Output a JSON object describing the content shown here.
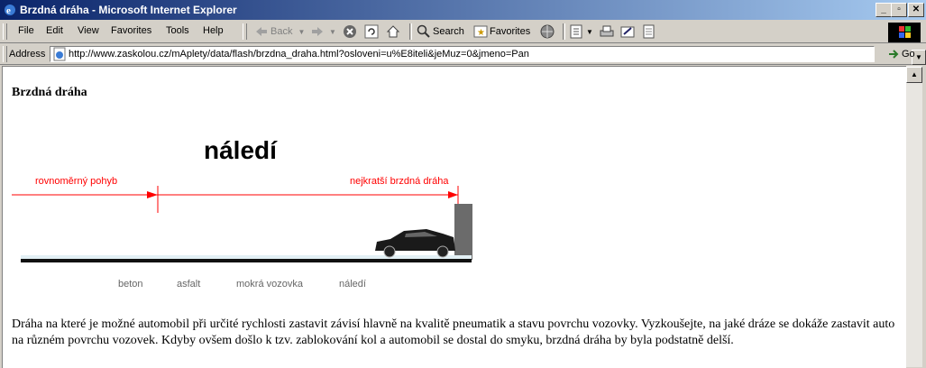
{
  "window": {
    "title": "Brzdná dráha - Microsoft Internet Explorer",
    "controls": {
      "minimize": "_",
      "maximize": "▫",
      "close": "✕"
    }
  },
  "menu": [
    "File",
    "Edit",
    "View",
    "Favorites",
    "Tools",
    "Help"
  ],
  "toolbar": {
    "back_label": "Back",
    "search_label": "Search",
    "favorites_label": "Favorites"
  },
  "address": {
    "label": "Address",
    "url": "http://www.zaskolou.cz/mAplety/data/flash/brzdna_draha.html?osloveni=u%E8iteli&jeMuz=0&jmeno=Pan",
    "go_label": "Go"
  },
  "page": {
    "title": "Brzdná dráha",
    "description": "Dráha na které je možné automobil při určité rychlosti zastavit závisí hlavně na kvalitě pneumatik a stavu povrchu vozovky. Vyzkoušejte, na jaké dráze se dokáže zastavit auto na různém povrchu vozovek. Kdyby ovšem došlo k tzv. zablokování kol a automobil se dostal do smyku, brzdná dráha by byla podstatně delší."
  },
  "simulation": {
    "surface_title": "náledí",
    "label_left": "rovnoměrný pohyb",
    "label_right": "nejkratší brzdná dráha",
    "surfaces": [
      "beton",
      "asfalt",
      "mokrá vozovka",
      "náledí"
    ],
    "accent_color": "#ff0000"
  }
}
